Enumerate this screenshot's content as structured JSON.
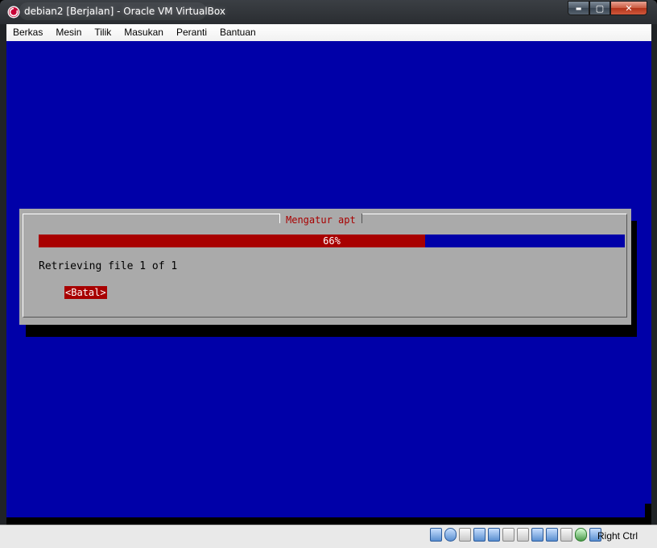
{
  "window": {
    "title": "debian2 [Berjalan] - Oracle VM VirtualBox",
    "minimize_glyph": "▬",
    "maximize_glyph": "▢",
    "close_glyph": "✕"
  },
  "menubar": {
    "items": [
      "Berkas",
      "Mesin",
      "Tilik",
      "Masukan",
      "Peranti",
      "Bantuan"
    ]
  },
  "installer": {
    "dialog_title": "Mengatur apt",
    "progress_percent": 66,
    "progress_label": "66%",
    "status_text": "Retrieving file 1 of 1",
    "cancel_label": "<Batal>"
  },
  "statusbar": {
    "icons": [
      "hard-disk-icon",
      "optical-drive-icon",
      "audio-icon",
      "network-icon",
      "usb-icon",
      "pencil-icon",
      "shared-folders-icon",
      "display-icon",
      "video-capture-icon",
      "clipboard-icon",
      "mouse-integration-icon",
      "keyboard-capture-icon"
    ],
    "host_key": "Right Ctrl"
  },
  "colors": {
    "screen_bg": "#0000a8",
    "dialog_bg": "#aaaaaa",
    "accent_red": "#a80000"
  }
}
